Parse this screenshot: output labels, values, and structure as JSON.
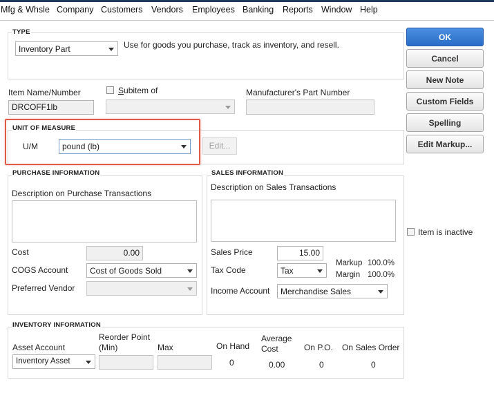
{
  "menu": {
    "items": [
      "Mfg & Whsle",
      "Company",
      "Customers",
      "Vendors",
      "Employees",
      "Banking",
      "Reports",
      "Window",
      "Help"
    ]
  },
  "buttons": {
    "ok": "OK",
    "cancel": "Cancel",
    "new_note": "New Note",
    "custom_fields": "Custom Fields",
    "spelling": "Spelling",
    "edit_markup": "Edit Markup..."
  },
  "type_section": {
    "title": "TYPE",
    "selected": "Inventory Part",
    "description": "Use for goods you purchase, track as inventory, and resell."
  },
  "item": {
    "name_label": "Item Name/Number",
    "name_value": "DRCOFF1lb",
    "subitem_label": "Subitem of",
    "subitem_value": "",
    "mfr_label": "Manufacturer's Part Number",
    "mfr_value": ""
  },
  "unit_of_measure": {
    "title": "UNIT OF MEASURE",
    "um_label": "U/M",
    "um_value": "pound (lb)",
    "edit_label": "Edit..."
  },
  "purchase": {
    "title": "PURCHASE INFORMATION",
    "desc_label": "Description on Purchase Transactions",
    "desc_value": "",
    "cost_label": "Cost",
    "cost_value": "0.00",
    "cogs_label": "COGS Account",
    "cogs_value": "Cost of Goods Sold",
    "vendor_label": "Preferred Vendor",
    "vendor_value": ""
  },
  "sales": {
    "title": "SALES INFORMATION",
    "desc_label": "Description on Sales Transactions",
    "desc_value": "",
    "price_label": "Sales Price",
    "price_value": "15.00",
    "tax_label": "Tax Code",
    "tax_value": "Tax",
    "markup_label": "Markup",
    "markup_value": "100.0%",
    "margin_label": "Margin",
    "margin_value": "100.0%",
    "income_label": "Income Account",
    "income_value": "Merchandise Sales"
  },
  "inactive_label": "Item is inactive",
  "inventory": {
    "title": "INVENTORY INFORMATION",
    "asset_label": "Asset Account",
    "asset_value": "Inventory Asset",
    "reorder_label_1": "Reorder Point",
    "reorder_label_2": "(Min)",
    "reorder_value": "",
    "max_label": "Max",
    "max_value": "",
    "on_hand_label": "On Hand",
    "on_hand_value": "0",
    "avg_cost_label_1": "Average",
    "avg_cost_label_2": "Cost",
    "avg_cost_value": "0.00",
    "on_po_label": "On P.O.",
    "on_po_value": "0",
    "on_so_label": "On Sales Order",
    "on_so_value": "0"
  },
  "colors": {
    "primary_button": "#2a6cc8",
    "highlight": "#e05a4a"
  }
}
